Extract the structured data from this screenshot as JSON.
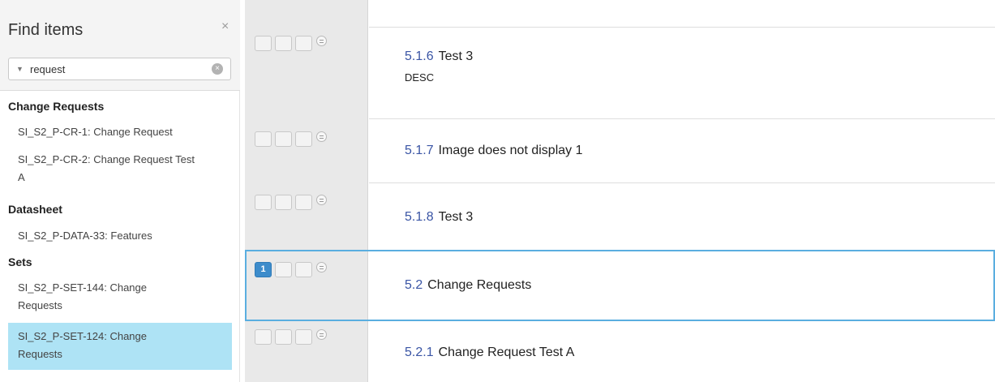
{
  "find_panel": {
    "title": "Find items",
    "close_glyph": "×",
    "search": {
      "value": "request",
      "placeholder": "",
      "dropdown_glyph": "▼",
      "clear_glyph": "×"
    },
    "groups": [
      {
        "heading": "Change Requests",
        "items": [
          {
            "label": "SI_S2_P-CR-1: Change Request"
          },
          {
            "label": "SI_S2_P-CR-2: Change Request Test A"
          }
        ]
      },
      {
        "heading": "Datasheet",
        "items": [
          {
            "label": "SI_S2_P-DATA-33: Features"
          }
        ]
      },
      {
        "heading": "Sets",
        "items": [
          {
            "label": "SI_S2_P-SET-144: Change Requests"
          },
          {
            "label": "SI_S2_P-SET-124: Change Requests",
            "selected": true
          }
        ]
      }
    ]
  },
  "gutter": {
    "comment_badge_count": "1"
  },
  "document": {
    "sections": [
      {
        "number": "5.1.6",
        "title": "Test 3",
        "description": "DESC"
      },
      {
        "number": "5.1.7",
        "title": "Image does not display 1"
      },
      {
        "number": "5.1.8",
        "title": "Test 3"
      },
      {
        "number": "5.2",
        "title": "Change Requests",
        "selected": true
      },
      {
        "number": "5.2.1",
        "title": "Change Request Test A"
      }
    ]
  },
  "colors": {
    "accent_blue": "#3d8ccb",
    "selection_blue": "#aee3f5",
    "section_number": "#3a55a5",
    "highlight_border": "#5aaee0"
  }
}
